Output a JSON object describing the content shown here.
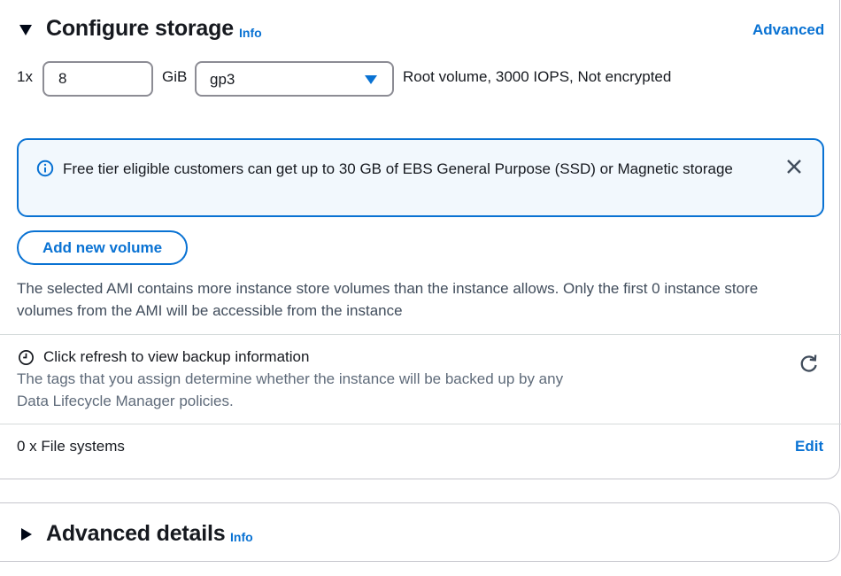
{
  "configure_storage": {
    "title": "Configure storage",
    "info_label": "Info",
    "advanced_link": "Advanced",
    "volume_count": "1x",
    "volume_size": "8",
    "size_unit": "GiB",
    "volume_type": "gp3",
    "volume_summary": "Root volume,  3000 IOPS,  Not encrypted",
    "alert_text": "Free tier eligible customers can get up to 30 GB of EBS General Purpose (SSD) or Magnetic storage",
    "add_volume_button": "Add new volume",
    "ami_note": "The selected AMI contains more instance store volumes than the instance allows. Only the first 0 instance store volumes from the AMI will be accessible from the instance",
    "backup_title": "Click refresh to view backup information",
    "backup_desc_line1": "The tags that you assign determine whether the instance will be backed up by any",
    "backup_desc_line2": "Data Lifecycle Manager policies.",
    "file_systems": "0 x File systems",
    "edit_link": "Edit"
  },
  "advanced_details": {
    "title": "Advanced details",
    "info_label": "Info"
  },
  "colors": {
    "link": "#0972d3",
    "alert_bg": "#f2f8fd",
    "text": "#16191f",
    "muted": "#5f6b7a"
  },
  "icons": [
    "caret-down-icon",
    "info-circle-icon",
    "close-icon",
    "dropdown-caret-icon",
    "clock-icon",
    "refresh-icon",
    "caret-right-icon"
  ]
}
